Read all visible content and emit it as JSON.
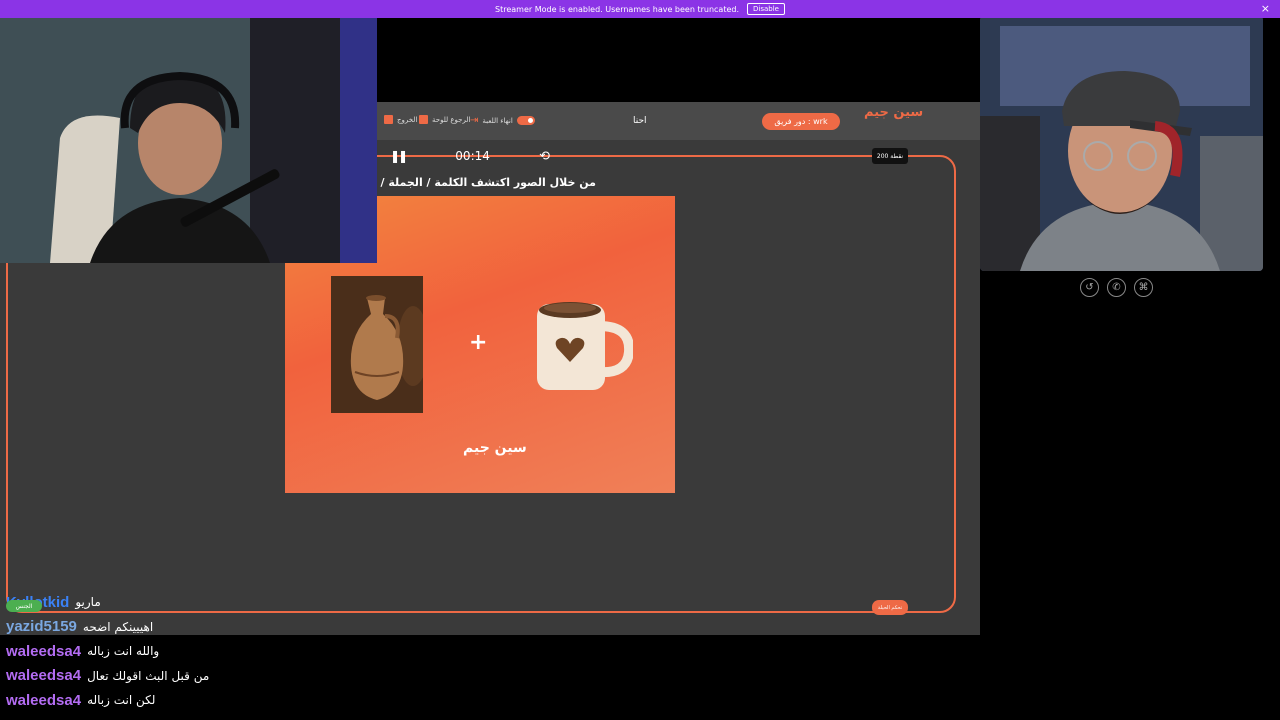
{
  "banner": {
    "text": "Streamer Mode is enabled. Usernames have been truncated.",
    "disable_label": "Disable",
    "close_label": "×"
  },
  "game": {
    "top": {
      "exit_label": "الخروج",
      "back_board_label": "الرجوع للوحة",
      "end_game_label": "انهاء اللعبة",
      "team_name": "احنا",
      "turn_label": "دور فريق : wrk",
      "logo_text": "سين جيم"
    },
    "timer": {
      "pause_icon": "❚❚",
      "time": "00:14",
      "reset_icon": "⟲"
    },
    "points_label": "200 نقطة",
    "question": "من خلال الصور اكتشف الكلمة / الجملة / الاسم",
    "card": {
      "plus": "+",
      "logo_text": "سين جيم"
    },
    "game_button_label": "تحكم الحيلة",
    "accent_color": "#ee6a46"
  },
  "cam_controls": [
    "↺",
    "✆",
    "⌘"
  ],
  "chat": {
    "badge_label": "الجنس",
    "messages": [
      {
        "user": "Kyllotkid",
        "text": "ماريو",
        "color": "#3b82f6"
      },
      {
        "user": "yazid5159",
        "text": "اهييينكم اضحه",
        "color": "#7aa7e0"
      },
      {
        "user": "waleedsa4",
        "text": "والله انت زباله",
        "color": "#b36cf2"
      },
      {
        "user": "waleedsa4",
        "text": "من قبل البث اقولك تعال",
        "color": "#b36cf2"
      },
      {
        "user": "waleedsa4",
        "text": "لكن انت زباله",
        "color": "#b36cf2"
      }
    ]
  }
}
